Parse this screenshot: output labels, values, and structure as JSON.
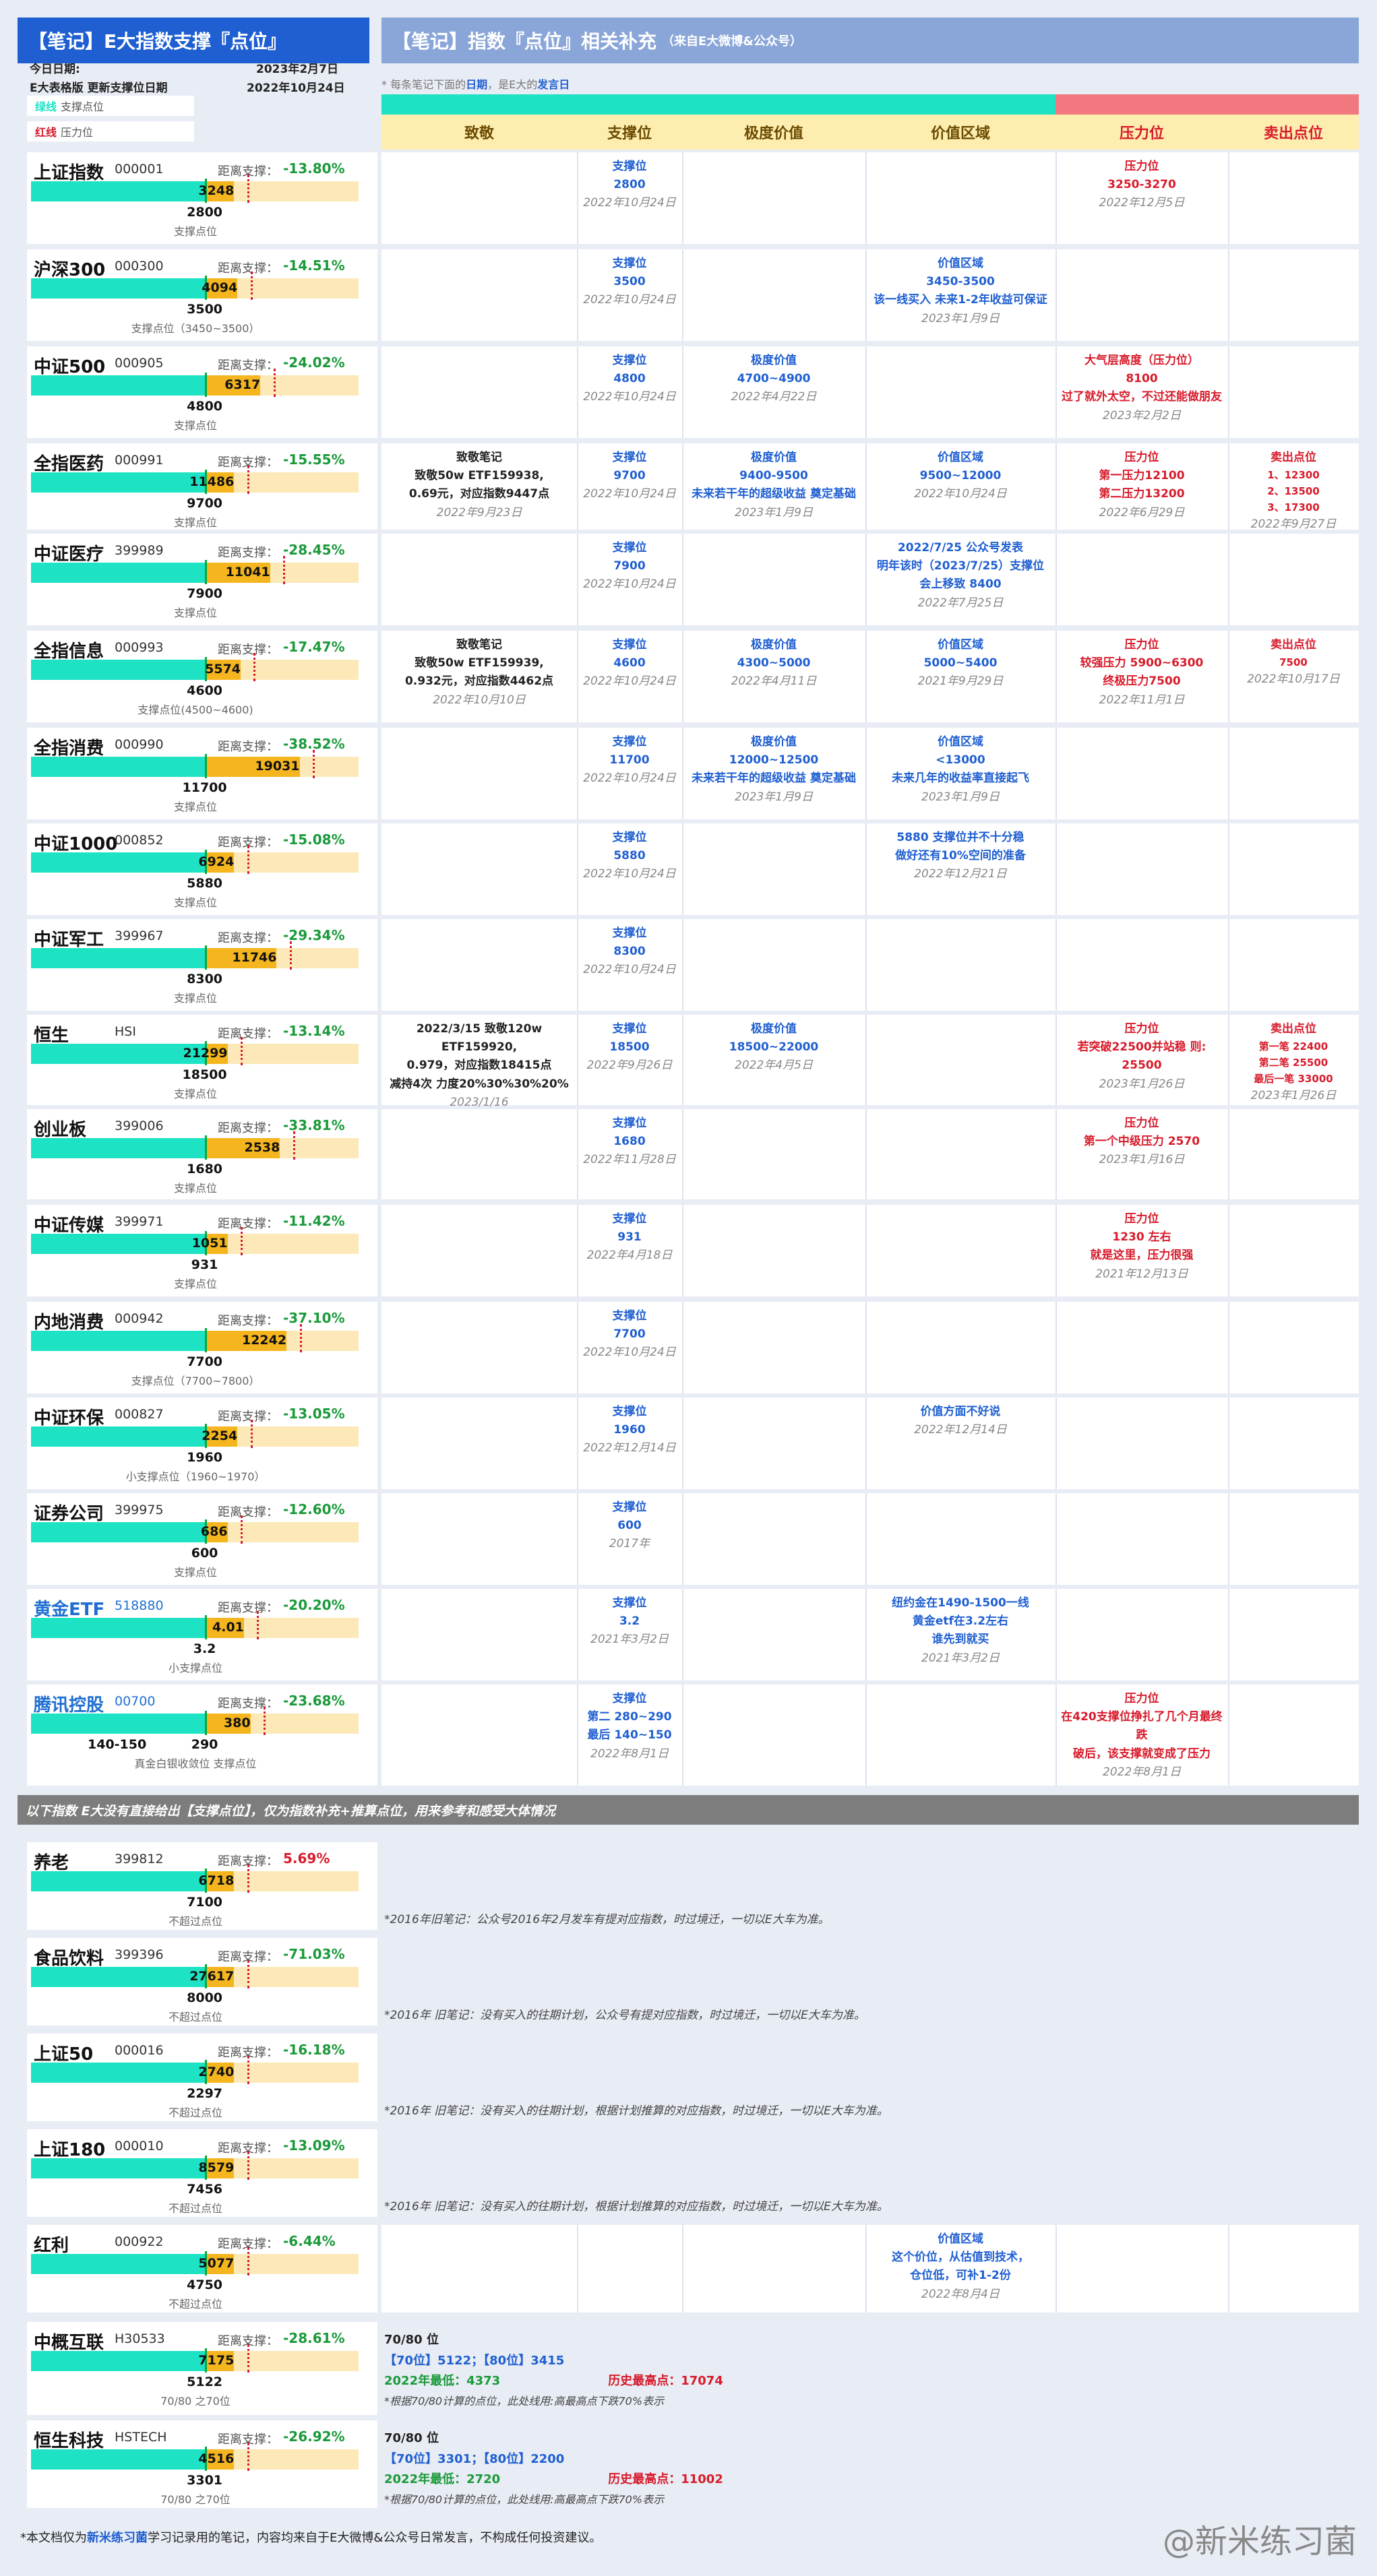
{
  "left_title": "【笔记】E大指数支撑『点位』",
  "right_title": "【笔记】指数『点位』相关补充",
  "right_subtitle": "（来自E大微博&公众号）",
  "today_label": "今日日期:",
  "today_value": "2023年2月7日",
  "update_label": "E大表格版 更新支撑位日期",
  "update_value": "2022年10月24日",
  "legend_green": "绿线",
  "legend_green_text": "支撑点位",
  "legend_red": "红线",
  "legend_red_text": "压力位",
  "hint_a": "* 每条笔记下面的",
  "hint_b": "日期",
  "hint_c": "，是E大的",
  "hint_d": "发言日",
  "headers": [
    "致敬",
    "支撑位",
    "极度价值",
    "价值区域",
    "压力位",
    "卖出点位"
  ],
  "dist_label": "距离支撑：",
  "colors": {
    "green": "#1de3c4",
    "orange": "#f5b51f",
    "light": "#fde9b8",
    "blue": "#1f5fd1",
    "red": "#d81b2b"
  },
  "rows": [
    {
      "name": "上证指数",
      "code": "000001",
      "pct": "-13.80%",
      "sup": "2800",
      "pres": "3248",
      "lbl": "支撑点位",
      "fill": 0.53,
      "cur": 0.62,
      "c": [
        "",
        "支撑位|2800|2022年10月24日",
        "",
        "",
        "压力位|3250-3270|2022年12月5日",
        ""
      ]
    },
    {
      "name": "沪深300",
      "code": "000300",
      "pct": "-14.51%",
      "sup": "3500",
      "pres": "4094",
      "lbl": "支撑点位（3450~3500）",
      "fill": 0.53,
      "cur": 0.63,
      "c": [
        "",
        "支撑位|3500|2022年10月24日",
        "",
        "价值区域|3450-3500|该一线买入 未来1-2年收益可保证|2023年1月9日",
        "",
        ""
      ]
    },
    {
      "name": "中证500",
      "code": "000905",
      "pct": "-24.02%",
      "sup": "4800",
      "pres": "6317",
      "lbl": "支撑点位",
      "fill": 0.53,
      "cur": 0.7,
      "c": [
        "",
        "支撑位|4800|2022年10月24日",
        "极度价值|4700~4900|2022年4月22日",
        "",
        "大气层高度（压力位）|8100|过了就外太空，不过还能做朋友|2023年2月2日",
        ""
      ]
    },
    {
      "name": "全指医药",
      "code": "000991",
      "pct": "-15.55%",
      "sup": "9700",
      "pres": "11486",
      "lbl": "支撑点位",
      "fill": 0.53,
      "cur": 0.62,
      "c": [
        "致敬笔记|致敬50w ETF159938,|0.69元，对应指数9447点|2022年9月23日",
        "支撑位|9700|2022年10月24日",
        "极度价值|9400-9500|未来若干年的超级收益 奠定基础|2023年1月9日",
        "价值区域|9500~12000|2022年10月24日",
        "压力位|第一压力12100|第二压力13200|2022年6月29日",
        "卖出点位|1、12300|2、13500|3、17300|2022年9月27日"
      ]
    },
    {
      "name": "中证医疗",
      "code": "399989",
      "pct": "-28.45%",
      "sup": "7900",
      "pres": "11041",
      "lbl": "支撑点位",
      "fill": 0.53,
      "cur": 0.73,
      "c": [
        "",
        "支撑位|7900|2022年10月24日",
        "",
        "2022/7/25 公众号发表|明年该时（2023/7/25）支撑位|会上移致 8400|2022年7月25日",
        "",
        ""
      ]
    },
    {
      "name": "全指信息",
      "code": "000993",
      "pct": "-17.47%",
      "sup": "4600",
      "pres": "5574",
      "lbl": "支撑点位(4500~4600)",
      "fill": 0.53,
      "cur": 0.64,
      "c": [
        "致敬笔记|致敬50w ETF159939,|0.932元，对应指数4462点|2022年10月10日",
        "支撑位|4600|2022年10月24日",
        "极度价值|4300~5000|2022年4月11日",
        "价值区域|5000~5400|2021年9月29日",
        "压力位|较强压力 5900~6300|终极压力7500|2022年11月1日",
        "卖出点位|7500|2022年10月17日"
      ]
    },
    {
      "name": "全指消费",
      "code": "000990",
      "pct": "-38.52%",
      "sup": "11700",
      "pres": "19031",
      "lbl": "支撑点位",
      "fill": 0.53,
      "cur": 0.82,
      "c": [
        "",
        "支撑位|11700|2022年10月24日",
        "极度价值|12000~12500|未来若干年的超级收益 奠定基础|2023年1月9日",
        "价值区域|<13000|未来几年的收益率直接起飞|2023年1月9日",
        "",
        ""
      ]
    },
    {
      "name": "中证1000",
      "code": "000852",
      "pct": "-15.08%",
      "sup": "5880",
      "pres": "6924",
      "lbl": "支撑点位",
      "fill": 0.53,
      "cur": 0.62,
      "c": [
        "",
        "支撑位|5880|2022年10月24日",
        "",
        "5880 支撑位并不十分稳|做好还有10%空间的准备|2022年12月21日",
        "",
        ""
      ]
    },
    {
      "name": "中证军工",
      "code": "399967",
      "pct": "-29.34%",
      "sup": "8300",
      "pres": "11746",
      "lbl": "支撑点位",
      "fill": 0.53,
      "cur": 0.75,
      "c": [
        "",
        "支撑位|8300|2022年10月24日",
        "",
        "",
        "",
        ""
      ]
    },
    {
      "name": "恒生",
      "code": "HSI",
      "pct": "-13.14%",
      "sup": "18500",
      "pres": "21299",
      "lbl": "支撑点位",
      "fill": 0.53,
      "cur": 0.6,
      "c": [
        "2022/3/15 致敬120w ETF159920,|0.979，对应指数18415点|减持4次 力度20%30%30%20%|2023/1/16",
        "支撑位|18500|2022年9月26日",
        "极度价值|18500~22000|2022年4月5日",
        "",
        "压力位|若突破22500并站稳 则:|25500|2023年1月26日",
        "卖出点位|第一笔 22400|第二笔 25500|最后一笔 33000|2023年1月26日"
      ]
    },
    {
      "name": "创业板",
      "code": "399006",
      "pct": "-33.81%",
      "sup": "1680",
      "pres": "2538",
      "lbl": "支撑点位",
      "fill": 0.53,
      "cur": 0.76,
      "c": [
        "",
        "支撑位|1680|2022年11月28日",
        "",
        "",
        "压力位|第一个中级压力 2570|2023年1月16日",
        ""
      ]
    },
    {
      "name": "中证传媒",
      "code": "399971",
      "pct": "-11.42%",
      "sup": "931",
      "pres": "1051",
      "lbl": "支撑点位",
      "fill": 0.53,
      "cur": 0.6,
      "c": [
        "",
        "支撑位|931|2022年4月18日",
        "",
        "",
        "压力位|1230 左右|就是这里，压力很强|2021年12月13日",
        ""
      ]
    },
    {
      "name": "内地消费",
      "code": "000942",
      "pct": "-37.10%",
      "sup": "7700",
      "pres": "12242",
      "lbl": "支撑点位（7700~7800）",
      "fill": 0.53,
      "cur": 0.78,
      "c": [
        "",
        "支撑位|7700|2022年10月24日",
        "",
        "",
        "",
        ""
      ]
    },
    {
      "name": "中证环保",
      "code": "000827",
      "pct": "-13.05%",
      "sup": "1960",
      "pres": "2254",
      "lbl": "小支撑点位（1960~1970）",
      "fill": 0.53,
      "cur": 0.63,
      "c": [
        "",
        "支撑位|1960|2022年12月14日",
        "",
        "价值方面不好说|2022年12月14日",
        "",
        ""
      ]
    },
    {
      "name": "证券公司",
      "code": "399975",
      "pct": "-12.60%",
      "sup": "600",
      "pres": "686",
      "lbl": "支撑点位",
      "fill": 0.53,
      "cur": 0.6,
      "c": [
        "",
        "支撑位|600|2017年",
        "",
        "",
        "",
        ""
      ]
    },
    {
      "name": "黄金ETF",
      "code": "518880",
      "pct": "-20.20%",
      "sup": "3.2",
      "pres": "4.01",
      "lbl": "小支撑点位",
      "fill": 0.53,
      "cur": 0.65,
      "blue": true,
      "c": [
        "",
        "支撑位|3.2|2021年3月2日",
        "",
        "纽约金在1490-1500一线|黄金etf在3.2左右|谁先到就买|2021年3月2日",
        "",
        ""
      ]
    },
    {
      "name": "腾讯控股",
      "code": "00700",
      "pct": "-23.68%",
      "sup": "290",
      "pres": "380",
      "lbl": "真金白银收敛位    支撑点位",
      "fill": 0.53,
      "cur": 0.67,
      "blue": true,
      "sup2": "140-150",
      "c": [
        "",
        "支撑位|第二 280~290|最后 140~150|2022年8月1日",
        "",
        "",
        "压力位|在420支撑位挣扎了几个月最终跌|破后，该支撑就变成了压力|2022年8月1日",
        ""
      ]
    }
  ],
  "separator": "以下指数 E大没有直接给出【支撑点位】，仅为指数补充+推算点位，用来参考和感受大体情况",
  "rows2": [
    {
      "name": "养老",
      "code": "399812",
      "pct": "5.69%",
      "sup": "7100",
      "pres": "6718",
      "lbl": "不超过点位",
      "note": "*2016年旧笔记：公众号2016年2月发车有提对应指数，时过境迁，一切以E大车为准。",
      "red": true
    },
    {
      "name": "食品饮料",
      "code": "399396",
      "pct": "-71.03%",
      "sup": "8000",
      "pres": "27617",
      "lbl": "不超过点位",
      "note": "*2016年 旧笔记：没有买入的往期计划，公众号有提对应指数，时过境迁，一切以E大车为准。"
    },
    {
      "name": "上证50",
      "code": "000016",
      "pct": "-16.18%",
      "sup": "2297",
      "pres": "2740",
      "lbl": "不超过点位",
      "note": "*2016年 旧笔记：没有买入的往期计划，根据计划推算的对应指数，时过境迁，一切以E大车为准。"
    },
    {
      "name": "上证180",
      "code": "000010",
      "pct": "-13.09%",
      "sup": "7456",
      "pres": "8579",
      "lbl": "不超过点位",
      "note": "*2016年 旧笔记：没有买入的往期计划，根据计划推算的对应指数，时过境迁，一切以E大车为准。"
    },
    {
      "name": "红利",
      "code": "000922",
      "pct": "-6.44%",
      "sup": "4750",
      "pres": "5077",
      "lbl": "不超过点位",
      "value": "价值区域|这个价位，从估值到技术，|仓位低，可补1-2份|2022年8月4日"
    },
    {
      "name": "中概互联",
      "code": "H30533",
      "pct": "-28.61%",
      "sup": "5122",
      "pres": "7175",
      "lbl": "70/80 之70位",
      "t1": "70/80 位",
      "t2a": "【70位】5122；【80位】3415",
      "t3a": "2022年最低：",
      "t3b": "4373",
      "t3c": "历史最高点：",
      "t3d": "17074",
      "t4": "*根据70/80计算的点位，此处线用:高最高点下跌70%表示"
    },
    {
      "name": "恒生科技",
      "code": "HSTECH",
      "pct": "-26.92%",
      "sup": "3301",
      "pres": "4516",
      "lbl": "70/80 之70位",
      "t1": "70/80 位",
      "t2a": "【70位】3301；【80位】2200",
      "t3a": "2022年最低：",
      "t3b": "2720",
      "t3c": "历史最高点：",
      "t3d": "11002",
      "t4": "*根据70/80计算的点位，此处线用:高最高点下跌70%表示"
    }
  ],
  "footer_a": "*本文档仅为",
  "footer_b": "新米练习菌",
  "footer_c": "学习记录用的笔记，内容均来自于E大微博&公众号日常发言，不构成任何投资建议。",
  "watermark": "@新米练习菌"
}
